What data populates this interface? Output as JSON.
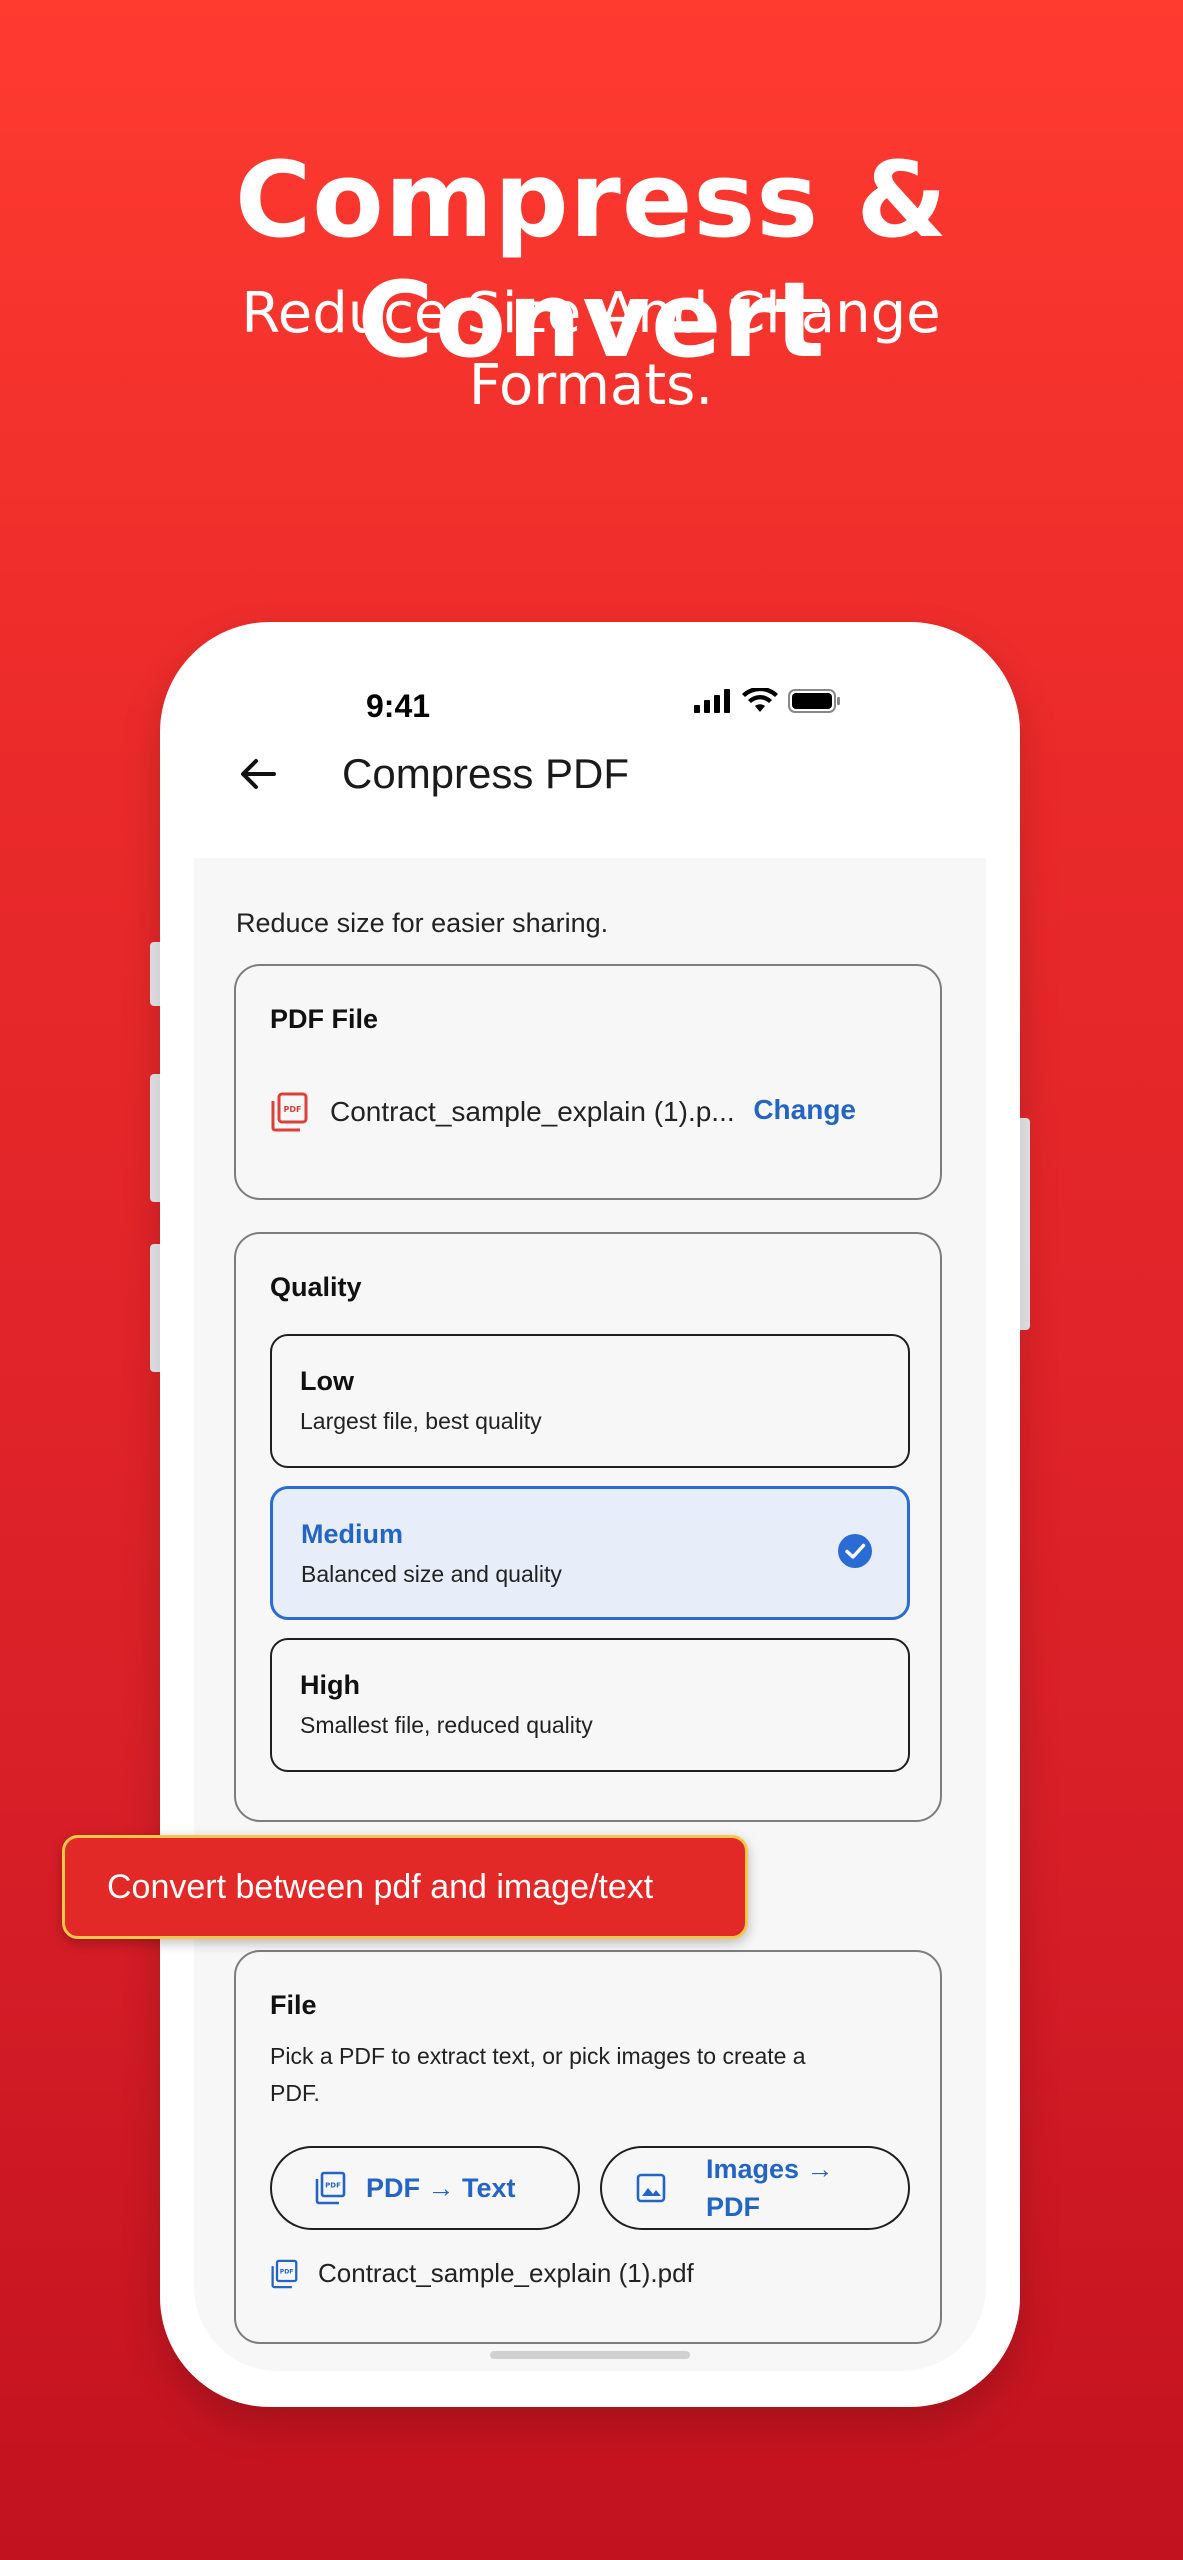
{
  "promo": {
    "headline": "Compress & Convert",
    "subline": "Reduce Size And Change Formats.",
    "callout": "Convert between pdf and image/text"
  },
  "status_bar": {
    "time": "9:41",
    "icons": [
      "signal-icon",
      "wifi-icon",
      "battery-icon"
    ]
  },
  "app_bar": {
    "back_icon": "arrow-left-icon",
    "title": "Compress PDF"
  },
  "compress": {
    "intro": "Reduce size for easier sharing.",
    "file_card": {
      "title": "PDF File",
      "file_icon": "pdf-file-icon",
      "file_name": "Contract_sample_explain (1).p...",
      "change_label": "Change"
    },
    "quality_card": {
      "title": "Quality",
      "selected": "Medium",
      "options": [
        {
          "name": "Low",
          "description": "Largest file, best quality"
        },
        {
          "name": "Medium",
          "description": "Balanced size and quality"
        },
        {
          "name": "High",
          "description": "Smallest file, reduced quality"
        }
      ]
    }
  },
  "convert": {
    "title": "File",
    "description_line1": "Pick a PDF to extract text, or pick images to create a",
    "description_line2": "PDF.",
    "pdf_to_text_label": "PDF → Text",
    "images_to_pdf_label_line1": "Images →",
    "images_to_pdf_label_line2": "PDF",
    "selected_file": "Contract_sample_explain (1).pdf"
  },
  "colors": {
    "background_top": "#ff3b30",
    "background_bottom": "#c2121f",
    "accent_blue": "#2465c4",
    "selected_fill": "#e8eef9",
    "callout_border": "#f5c64a",
    "pdf_icon_red": "#d9413a"
  }
}
